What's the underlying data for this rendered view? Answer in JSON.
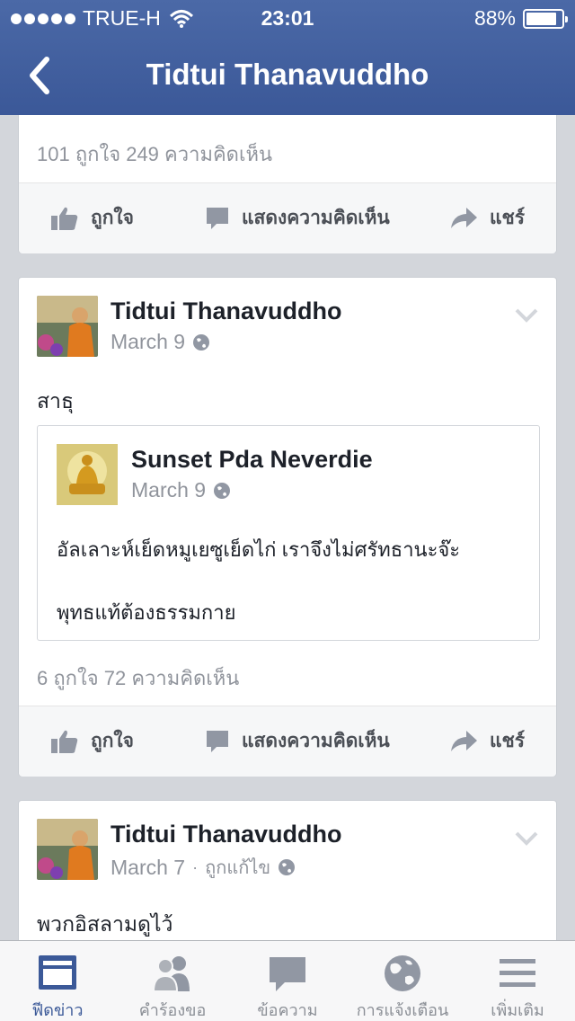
{
  "status_bar": {
    "carrier": "TRUE-H",
    "time": "23:01",
    "battery": "88%",
    "battery_level": 0.88
  },
  "nav": {
    "title": "Tidtui Thanavuddho"
  },
  "colors": {
    "brand": "#3b5998",
    "background": "#d3d6db"
  },
  "actions": {
    "like": "ถูกใจ",
    "comment": "แสดงความคิดเห็น",
    "share": "แชร์"
  },
  "posts": [
    {
      "counts": "101 ถูกใจ   249 ความคิดเห็น"
    },
    {
      "author": "Tidtui Thanavuddho",
      "date": "March 9",
      "text": "สาธุ",
      "shared": {
        "author": "Sunset Pda Neverdie",
        "date": "March 9",
        "line1": "อัลเลาะห์เย็ดหมูเยซูเย็ดไก่ เราจึงไม่ศรัทธานะจ๊ะ",
        "line2": "พุทธแท้ต้องธรรมกาย"
      },
      "counts": "6 ถูกใจ   72 ความคิดเห็น"
    },
    {
      "author": "Tidtui Thanavuddho",
      "date": "March 7",
      "edited": "ถูกแก้ไข",
      "text": "พวกอิสลามดูไว้"
    }
  ],
  "tabs": [
    {
      "label": "ฟีดข่าว",
      "icon": "news-feed-icon",
      "active": true
    },
    {
      "label": "คำร้องขอ",
      "icon": "friend-requests-icon",
      "active": false
    },
    {
      "label": "ข้อความ",
      "icon": "messages-icon",
      "active": false
    },
    {
      "label": "การแจ้งเตือน",
      "icon": "globe-notifications-icon",
      "active": false
    },
    {
      "label": "เพิ่มเติม",
      "icon": "more-menu-icon",
      "active": false
    }
  ]
}
